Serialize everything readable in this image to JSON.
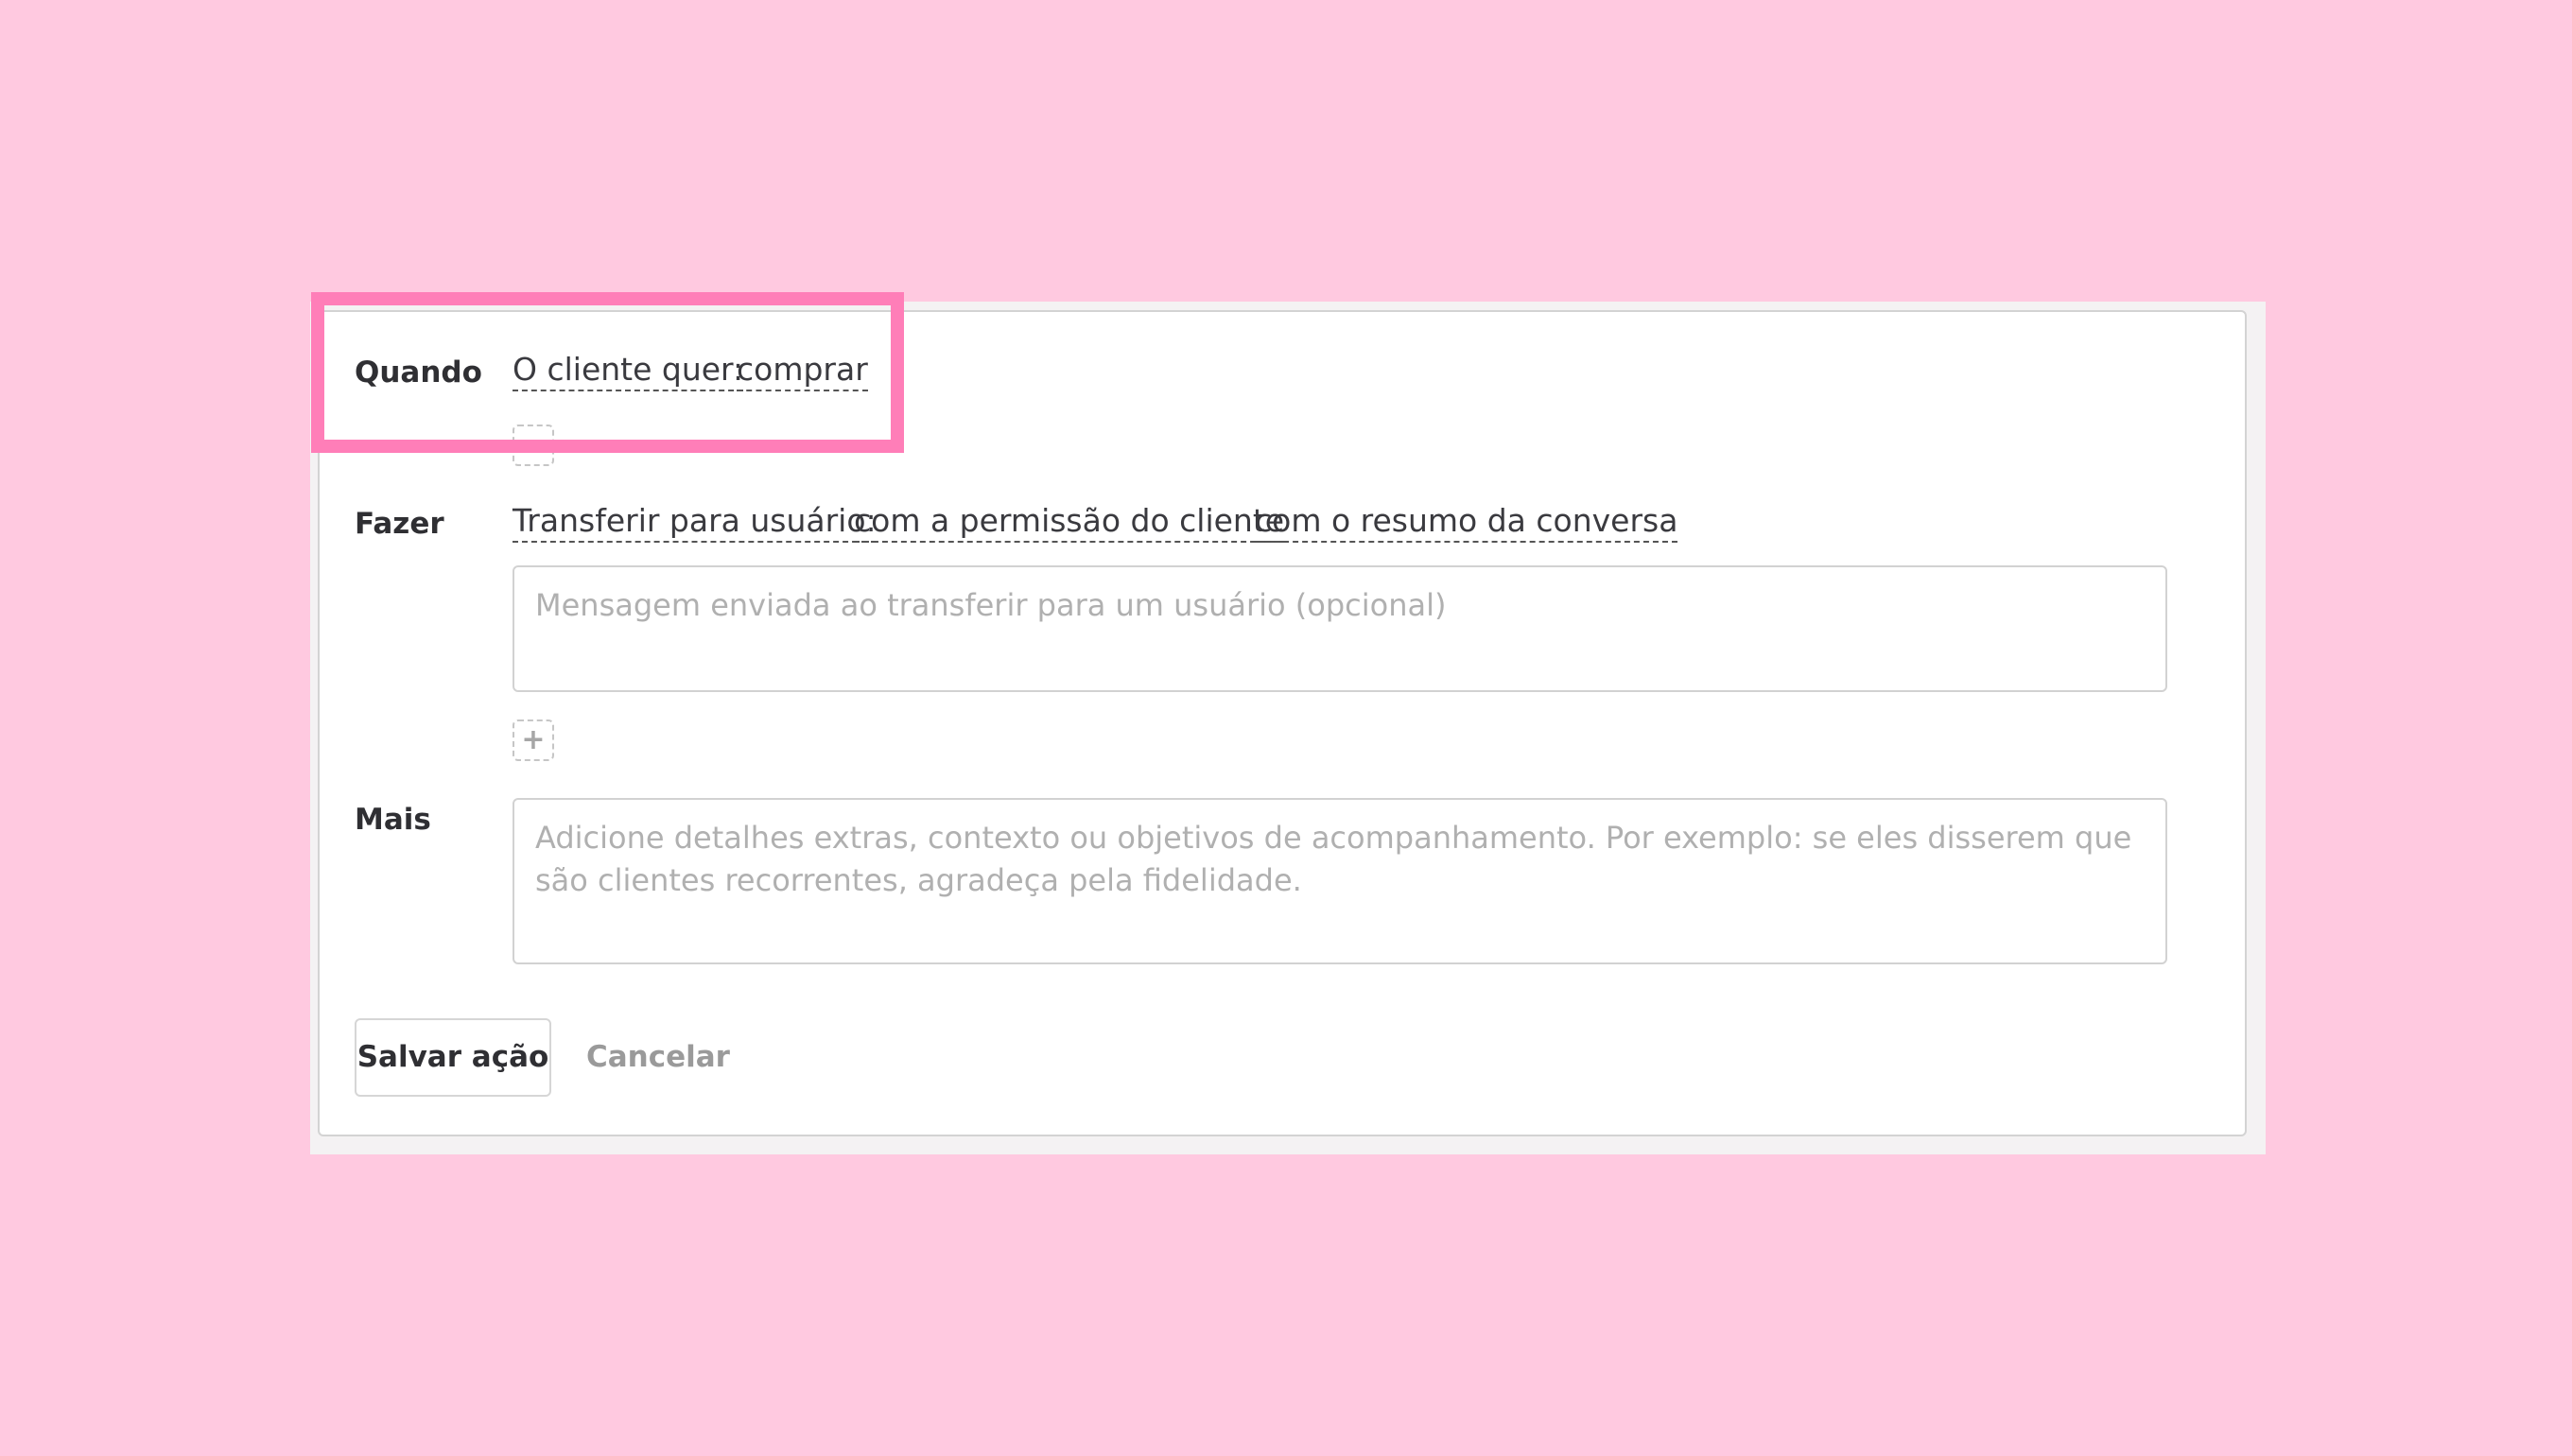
{
  "form": {
    "when": {
      "label": "Quando",
      "chips": [
        "O cliente quer:",
        "comprar"
      ]
    },
    "do": {
      "label": "Fazer",
      "chips": [
        "Transferir para usuário:",
        "com a permissão do cliente",
        "com o resumo da conversa"
      ],
      "message_placeholder": "Mensagem enviada ao transferir para um usuário (opcional)",
      "add_symbol": "+"
    },
    "more": {
      "label": "Mais",
      "placeholder": "Adicione detalhes extras, contexto ou objetivos de acompanhamento. Por exemplo: se eles disserem que são clientes recorrentes, agradeça pela fidelidade."
    },
    "actions": {
      "save_label": "Salvar ação",
      "cancel_label": "Cancelar"
    }
  },
  "colors": {
    "background": "#ffc9e0",
    "highlight": "#ff7eb8",
    "panel": "#ffffff"
  }
}
